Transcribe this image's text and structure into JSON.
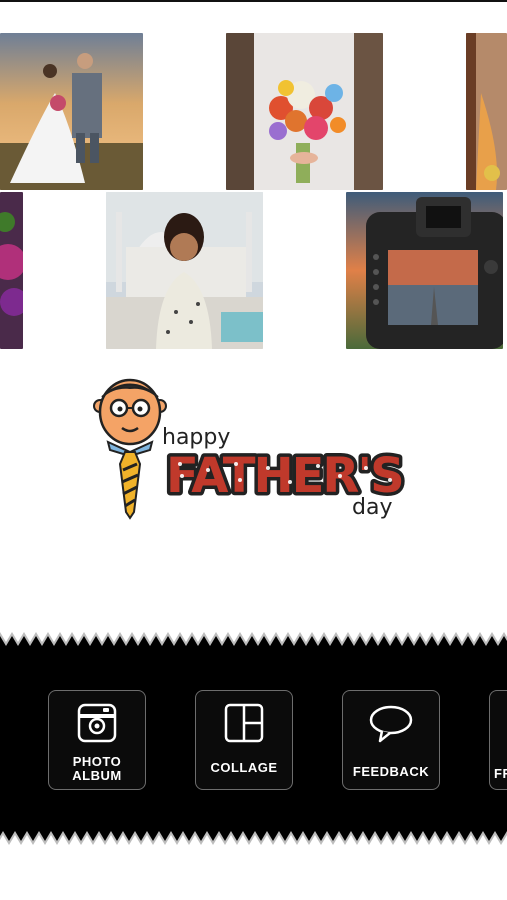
{
  "photos": [
    {
      "name": "wedding-couple-photo"
    },
    {
      "name": "bridal-bouquet-photo"
    },
    {
      "name": "bride-partial-photo"
    },
    {
      "name": "purple-flower-photo"
    },
    {
      "name": "woman-taj-mahal-photo"
    },
    {
      "name": "camera-back-photo"
    }
  ],
  "logo": {
    "happy": "happy",
    "fathers": "FATHER'S",
    "day": "day"
  },
  "menu": {
    "items": [
      {
        "label_line1": "PHOTO",
        "label_line2": "ALBUM",
        "icon": "camera-icon"
      },
      {
        "label_line1": "COLLAGE",
        "label_line2": "",
        "icon": "collage-grid-icon"
      },
      {
        "label_line1": "FEEDBACK",
        "label_line2": "",
        "icon": "speech-bubble-icon"
      },
      {
        "label_line1": "FR",
        "label_line2": "",
        "icon": ""
      }
    ]
  },
  "colors": {
    "band": "#000000",
    "band_border": "#bdbdbd",
    "button_border": "#6d6d6d"
  }
}
